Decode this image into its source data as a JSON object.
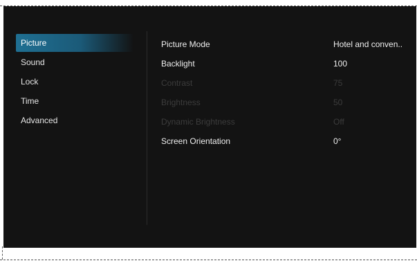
{
  "sidebar": {
    "items": [
      {
        "label": "Picture"
      },
      {
        "label": "Sound"
      },
      {
        "label": "Lock"
      },
      {
        "label": "Time"
      },
      {
        "label": "Advanced"
      }
    ]
  },
  "settings": {
    "rows": [
      {
        "label": "Picture Mode",
        "value": "Hotel and conven..",
        "enabled": true
      },
      {
        "label": "Backlight",
        "value": "100",
        "enabled": true
      },
      {
        "label": "Contrast",
        "value": "75",
        "enabled": false
      },
      {
        "label": "Brightness",
        "value": "50",
        "enabled": false
      },
      {
        "label": "Dynamic Brightness",
        "value": "Off",
        "enabled": false
      },
      {
        "label": "Screen Orientation",
        "value": "0°",
        "enabled": true
      }
    ]
  },
  "colors": {
    "accent": "#1f6f92",
    "background": "#131313"
  }
}
